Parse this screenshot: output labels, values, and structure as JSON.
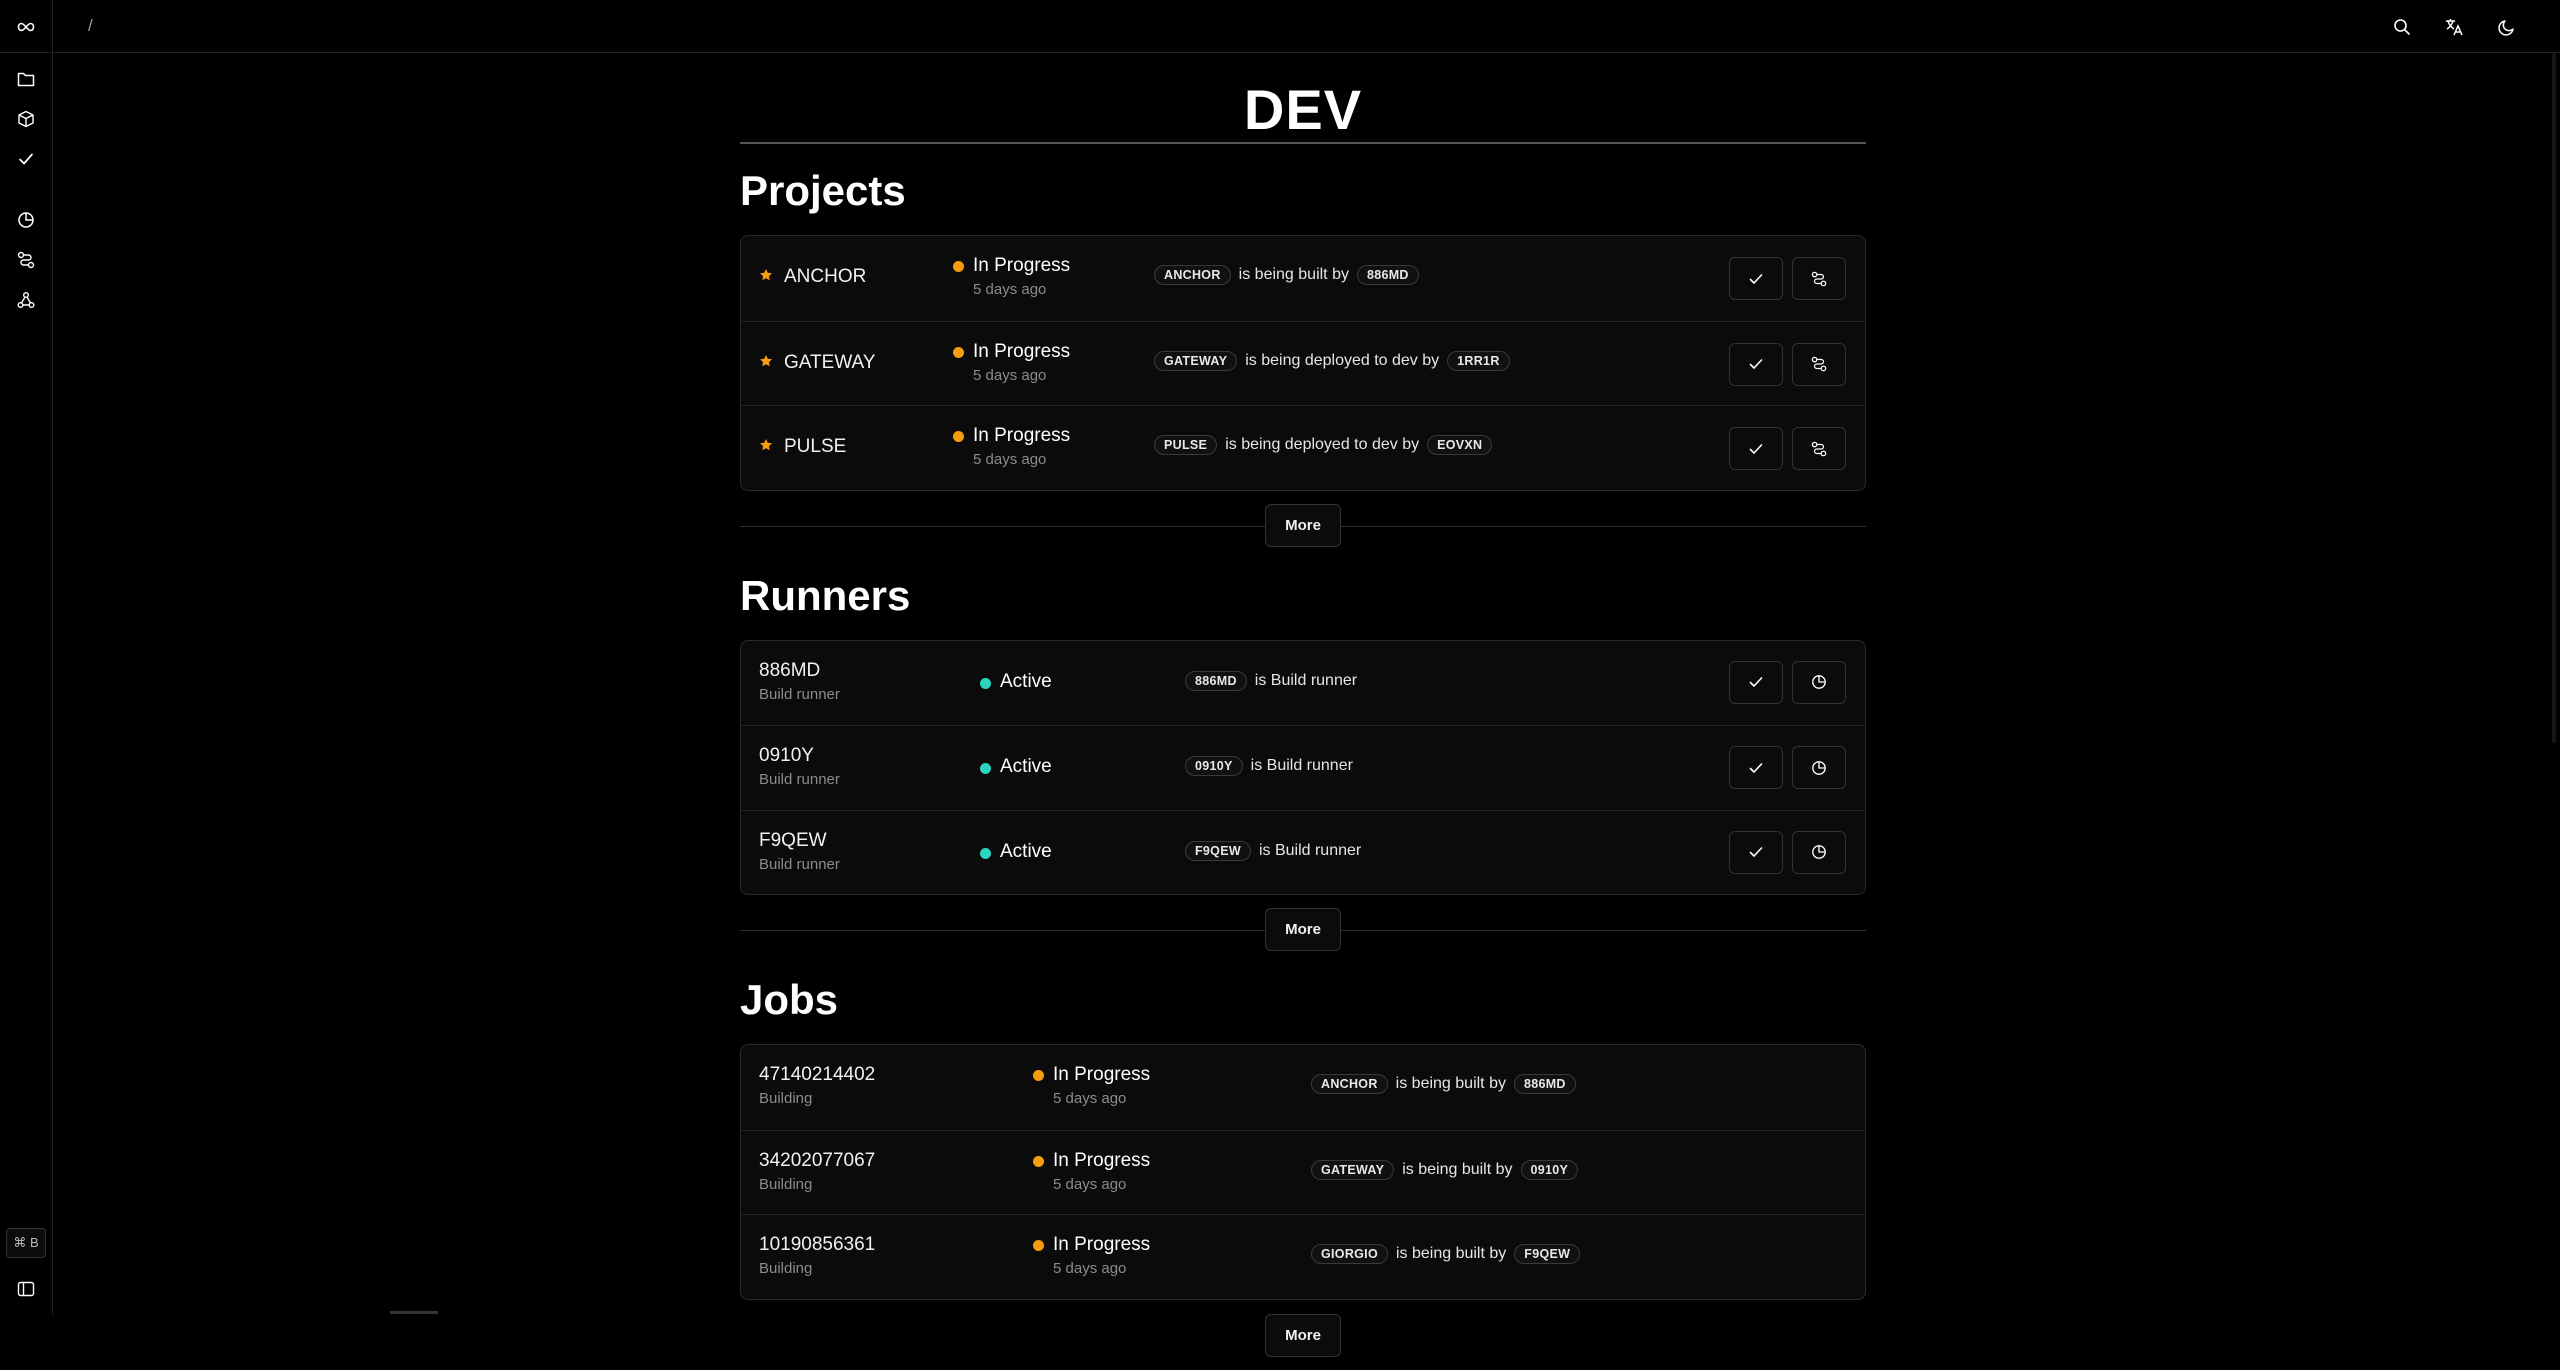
{
  "topbar": {
    "breadcrumb": "/",
    "icons": [
      "infinity-icon",
      "search-icon",
      "translate-icon",
      "moon-icon"
    ]
  },
  "sidebar": {
    "icons": [
      "folder-icon",
      "box-icon",
      "check-icon",
      "pie-chart-icon",
      "route-icon",
      "network-icon"
    ],
    "shortcut": "⌘ B"
  },
  "page": {
    "title": "DEV"
  },
  "projects": {
    "title": "Projects",
    "more_label": "More",
    "items": [
      {
        "name": "ANCHOR",
        "status": "In Progress",
        "time": "5 days ago",
        "tag1": "ANCHOR",
        "text": "is being built by",
        "tag2": "886MD"
      },
      {
        "name": "GATEWAY",
        "status": "In Progress",
        "time": "5 days ago",
        "tag1": "GATEWAY",
        "text": "is being deployed to dev by",
        "tag2": "1RR1R"
      },
      {
        "name": "PULSE",
        "status": "In Progress",
        "time": "5 days ago",
        "tag1": "PULSE",
        "text": "is being deployed to dev by",
        "tag2": "EOVXN"
      }
    ]
  },
  "runners": {
    "title": "Runners",
    "more_label": "More",
    "items": [
      {
        "name": "886MD",
        "sub": "Build runner",
        "status": "Active",
        "tag1": "886MD",
        "text": "is Build runner"
      },
      {
        "name": "0910Y",
        "sub": "Build runner",
        "status": "Active",
        "tag1": "0910Y",
        "text": "is Build runner"
      },
      {
        "name": "F9QEW",
        "sub": "Build runner",
        "status": "Active",
        "tag1": "F9QEW",
        "text": "is Build runner"
      }
    ]
  },
  "jobs": {
    "title": "Jobs",
    "more_label": "More",
    "items": [
      {
        "id": "47140214402",
        "sub": "Building",
        "status": "In Progress",
        "time": "5 days ago",
        "tag1": "ANCHOR",
        "text": "is being built by",
        "tag2": "886MD"
      },
      {
        "id": "34202077067",
        "sub": "Building",
        "status": "In Progress",
        "time": "5 days ago",
        "tag1": "GATEWAY",
        "text": "is being built by",
        "tag2": "0910Y"
      },
      {
        "id": "10190856361",
        "sub": "Building",
        "status": "In Progress",
        "time": "5 days ago",
        "tag1": "GIORGIO",
        "text": "is being built by",
        "tag2": "F9QEW"
      }
    ]
  },
  "colors": {
    "in_progress": "#f59e0b",
    "active": "#2dd4bf",
    "star": "#f59e0b"
  }
}
